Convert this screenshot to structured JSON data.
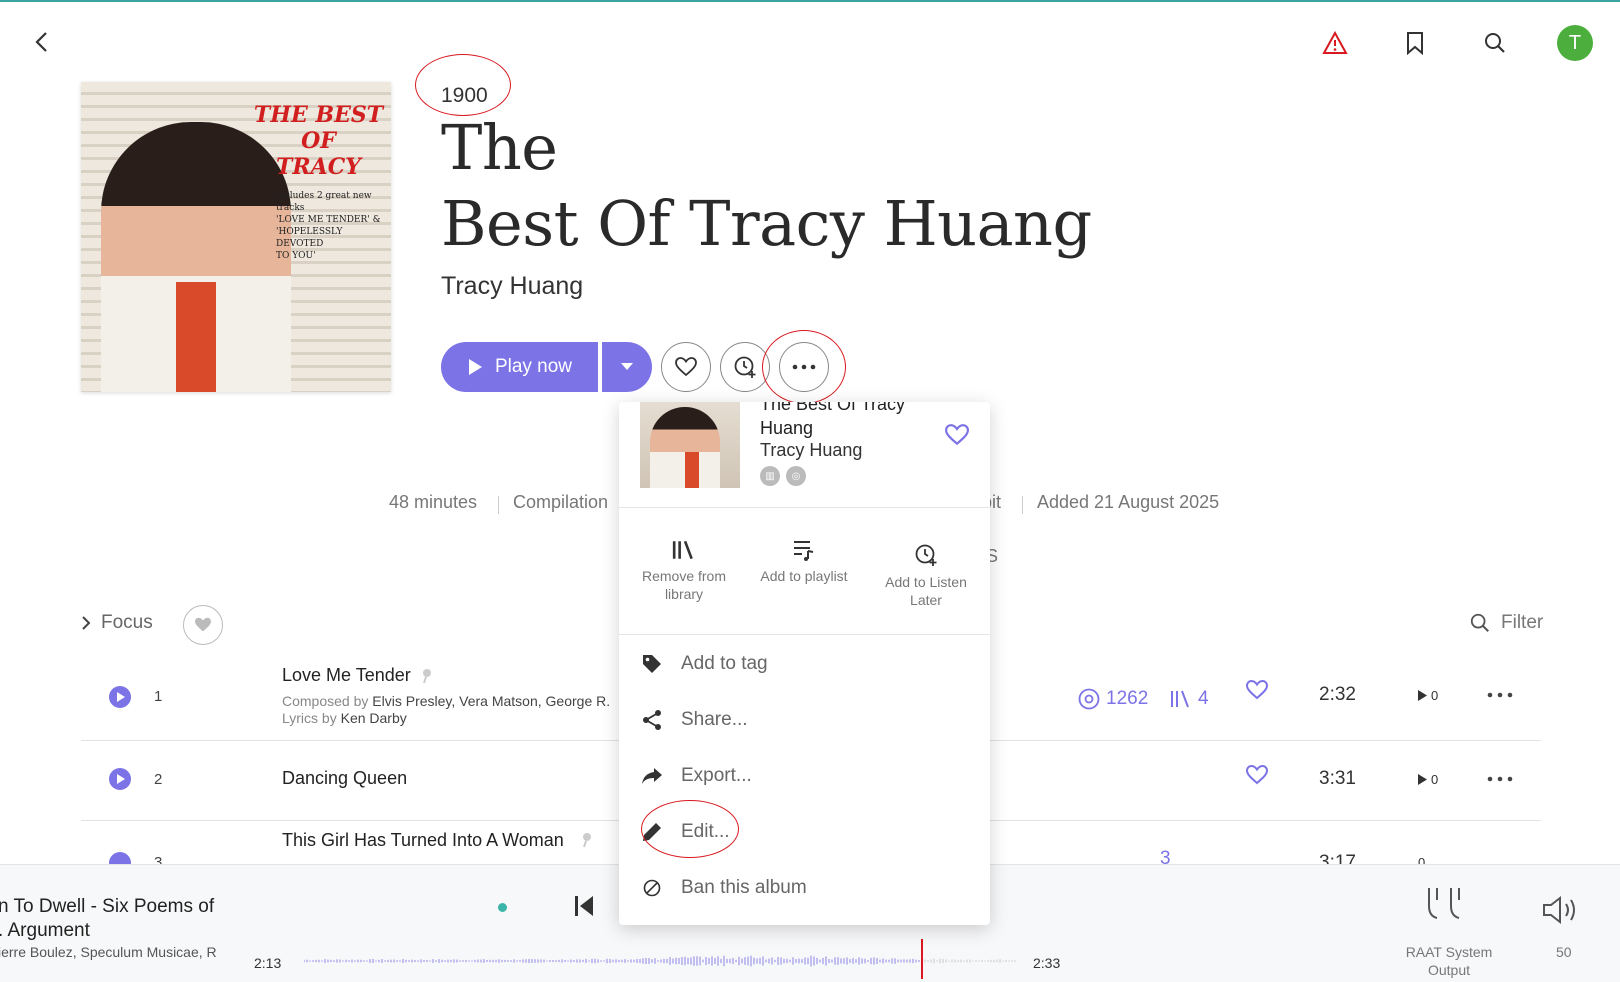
{
  "colors": {
    "accent": "#7c73e6",
    "alert": "#d9191f",
    "avatar": "#4caf3d",
    "annotation": "#d9191f"
  },
  "header": {
    "back_icon": "chevron-left-icon",
    "icons": [
      "warning-icon",
      "bookmark-icon",
      "search-icon"
    ],
    "avatar_letter": "T"
  },
  "album": {
    "year": "1900",
    "title_line1": "The",
    "title_line2": "Best Of Tracy Huang",
    "artist": "Tracy Huang",
    "cover_title": "THE BEST OF TRACY",
    "cover_text": "includes 2 great new tracks 'LOVE ME TENDER' & 'HOPELESSLY DEVOTED TO YOU'",
    "play_label": "Play now"
  },
  "meta": {
    "duration": "48 minutes",
    "type": "Compilation",
    "partial": "bit",
    "added": "Added 21 August 2025",
    "tab_partial": "S"
  },
  "list": {
    "focus_label": "Focus",
    "filter_label": "Filter"
  },
  "tracks": [
    {
      "num": "1",
      "title": "Love Me Tender",
      "composed_prefix": "Composed by",
      "composers": "Elvis Presley, Vera Matson, George R.",
      "lyrics_prefix": "Lyrics by",
      "lyricist": "Ken Darby",
      "plays": "1262",
      "libraries": "4",
      "duration": "2:32",
      "count": "0"
    },
    {
      "num": "2",
      "title": "Dancing Queen",
      "duration": "3:31",
      "count": "0"
    },
    {
      "num": "3",
      "title": "This Girl Has Turned Into A Woman",
      "plays": "3",
      "duration": "3:17",
      "count": "0"
    }
  ],
  "menu": {
    "album_title": "The Best Of Tracy Huang",
    "artist": "Tracy Huang",
    "actions": [
      {
        "label": "Remove from library",
        "icon": "library-icon"
      },
      {
        "label": "Add to playlist",
        "icon": "playlist-add-icon"
      },
      {
        "label": "Add to Listen Later",
        "icon": "clock-plus-icon"
      }
    ],
    "items": [
      {
        "label": "Add to tag",
        "icon": "tag-icon"
      },
      {
        "label": "Share...",
        "icon": "share-icon"
      },
      {
        "label": "Export...",
        "icon": "export-icon"
      },
      {
        "label": "Edit...",
        "icon": "pencil-icon"
      },
      {
        "label": "Ban this album",
        "icon": "ban-icon"
      }
    ]
  },
  "player": {
    "title_line1": "n To Dwell - Six Poems of",
    "title_line2": ". Argument",
    "subtitle": "ierre Boulez, Speculum Musicae, R",
    "elapsed": "2:13",
    "total": "2:33",
    "output_label": "RAAT System Output",
    "volume": "50"
  }
}
